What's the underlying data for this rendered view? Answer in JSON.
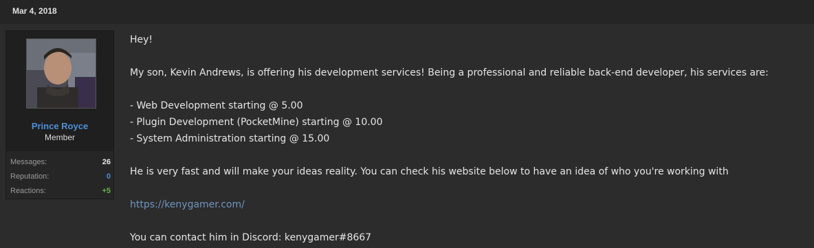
{
  "post": {
    "date": "Mar 4, 2018"
  },
  "user": {
    "name": "Prince Royce",
    "title": "Member",
    "stats": [
      {
        "label": "Messages:",
        "value": "26",
        "color": "#e6e6e6"
      },
      {
        "label": "Reputation:",
        "value": "0",
        "color": "#4d8fd8"
      },
      {
        "label": "Reactions:",
        "value": "+5",
        "color": "#6ab04c"
      }
    ]
  },
  "message": {
    "greeting": "Hey!",
    "intro": "My son, Kevin Andrews, is offering his development services! Being a professional and reliable back-end developer, his services are:",
    "services": [
      "- Web Development starting @ 5.00",
      "- Plugin Development (PocketMine) starting @ 10.00",
      "- System Administration starting @ 15.00"
    ],
    "pitch": "He is very fast and will make your ideas reality. You can check his website below to have an idea of who you're working with",
    "website": "https://kenygamer.com/",
    "contact": "You can contact him in Discord: kenygamer#8667"
  },
  "colors": {
    "background": "#2c2c2c",
    "username": "#4d8fd8",
    "link": "#6f95c1"
  }
}
